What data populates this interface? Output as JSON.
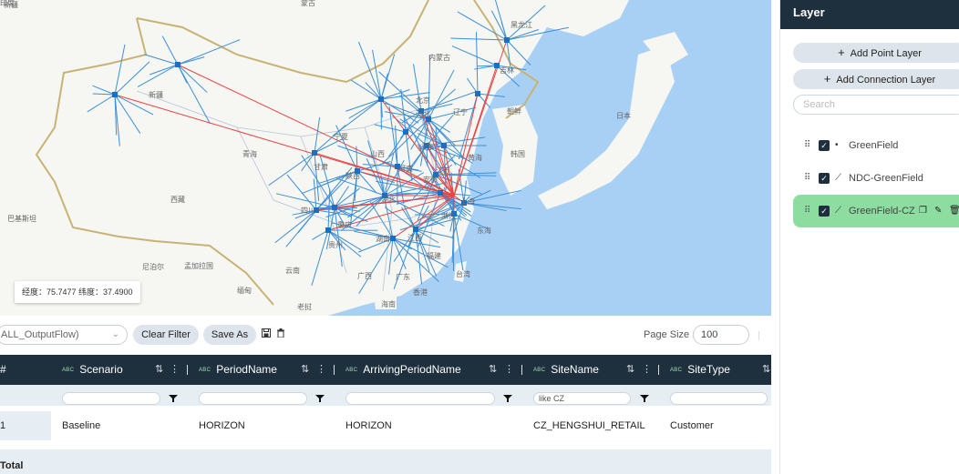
{
  "map": {
    "labels": {
      "xinjiang_top": "新疆",
      "mongolia": "蒙古",
      "heilongjiang": "黑龙江",
      "inner_mongolia": "内蒙古",
      "jilin": "吉林",
      "xinjiang": "新疆",
      "beijing": "北京",
      "hebei": "河北",
      "liaoning": "辽宁",
      "korea_north": "朝鲜",
      "japan": "日本",
      "korea_south": "韩国",
      "qinghai": "青海",
      "gansu": "甘肃",
      "ningxia": "宁夏",
      "shanxi": "山西",
      "shandong": "山东",
      "yellow_sea": "黄海",
      "shaanxi": "陕西",
      "henan": "河南",
      "tibet": "西藏",
      "sichuan": "四川",
      "chongqing": "重庆",
      "hubei": "湖北",
      "anhui": "安徽",
      "jiangsu": "江苏",
      "shanghai": "上海",
      "pakistan": "巴基斯坦",
      "nepal": "尼泊尔",
      "bangladesh": "孟加拉国",
      "guizhou": "贵州",
      "hunan": "湖南",
      "jiangxi": "江西",
      "zhejiang": "浙江",
      "east_sea": "东海",
      "fujian": "福建",
      "yunnan": "云南",
      "guangxi": "广西",
      "guangdong": "广东",
      "taiwan": "台湾",
      "myanmar": "缅甸",
      "hongkong": "香港",
      "laos": "老挝",
      "hainan": "海南",
      "india_top": "印度"
    },
    "coord_readout": "经度：75.7477 纬度：37.4900",
    "colors": {
      "land": "#f6f6f3",
      "sea": "#a8d0f5",
      "flow_spoke": "#3d8fd6",
      "flow_red": "#e84545",
      "site": "#1b6fc2",
      "border": "#c8b374"
    }
  },
  "toolbar": {
    "view_select_value": "ALL_OutputFlow)",
    "clear_filter": "Clear Filter",
    "save_as": "Save As",
    "save_icon": "save-icon",
    "delete_icon": "trash-icon",
    "page_size_label": "Page Size :",
    "page_size_value": "100"
  },
  "table": {
    "type_badge": "ABC",
    "columns": [
      {
        "label": "#"
      },
      {
        "label": "Scenario"
      },
      {
        "label": "PeriodName"
      },
      {
        "label": "ArrivingPeriodName"
      },
      {
        "label": "SiteName"
      },
      {
        "label": "SiteType"
      }
    ],
    "filters": [
      "",
      "",
      "",
      "like CZ",
      ""
    ],
    "rows": [
      {
        "num": "1",
        "scenario": "Baseline",
        "period": "HORIZON",
        "arriving": "HORIZON",
        "site": "CZ_HENGSHUI_RETAIL",
        "sitetype": "Customer"
      }
    ],
    "total_label": "Total"
  },
  "panel": {
    "title": "Layer",
    "add_point": "Add Point Layer",
    "add_connection": "Add Connection Layer",
    "search_placeholder": "Search",
    "layers": [
      {
        "name": "GreenField",
        "type_icon": "point-icon",
        "type_glyph": "•",
        "checked": true
      },
      {
        "name": "NDC-GreenField",
        "type_icon": "line-icon",
        "type_glyph": "⟋",
        "checked": true
      },
      {
        "name": "GreenField-CZ",
        "type_icon": "line-icon",
        "type_glyph": "⟋",
        "checked": true,
        "active": true
      }
    ]
  }
}
